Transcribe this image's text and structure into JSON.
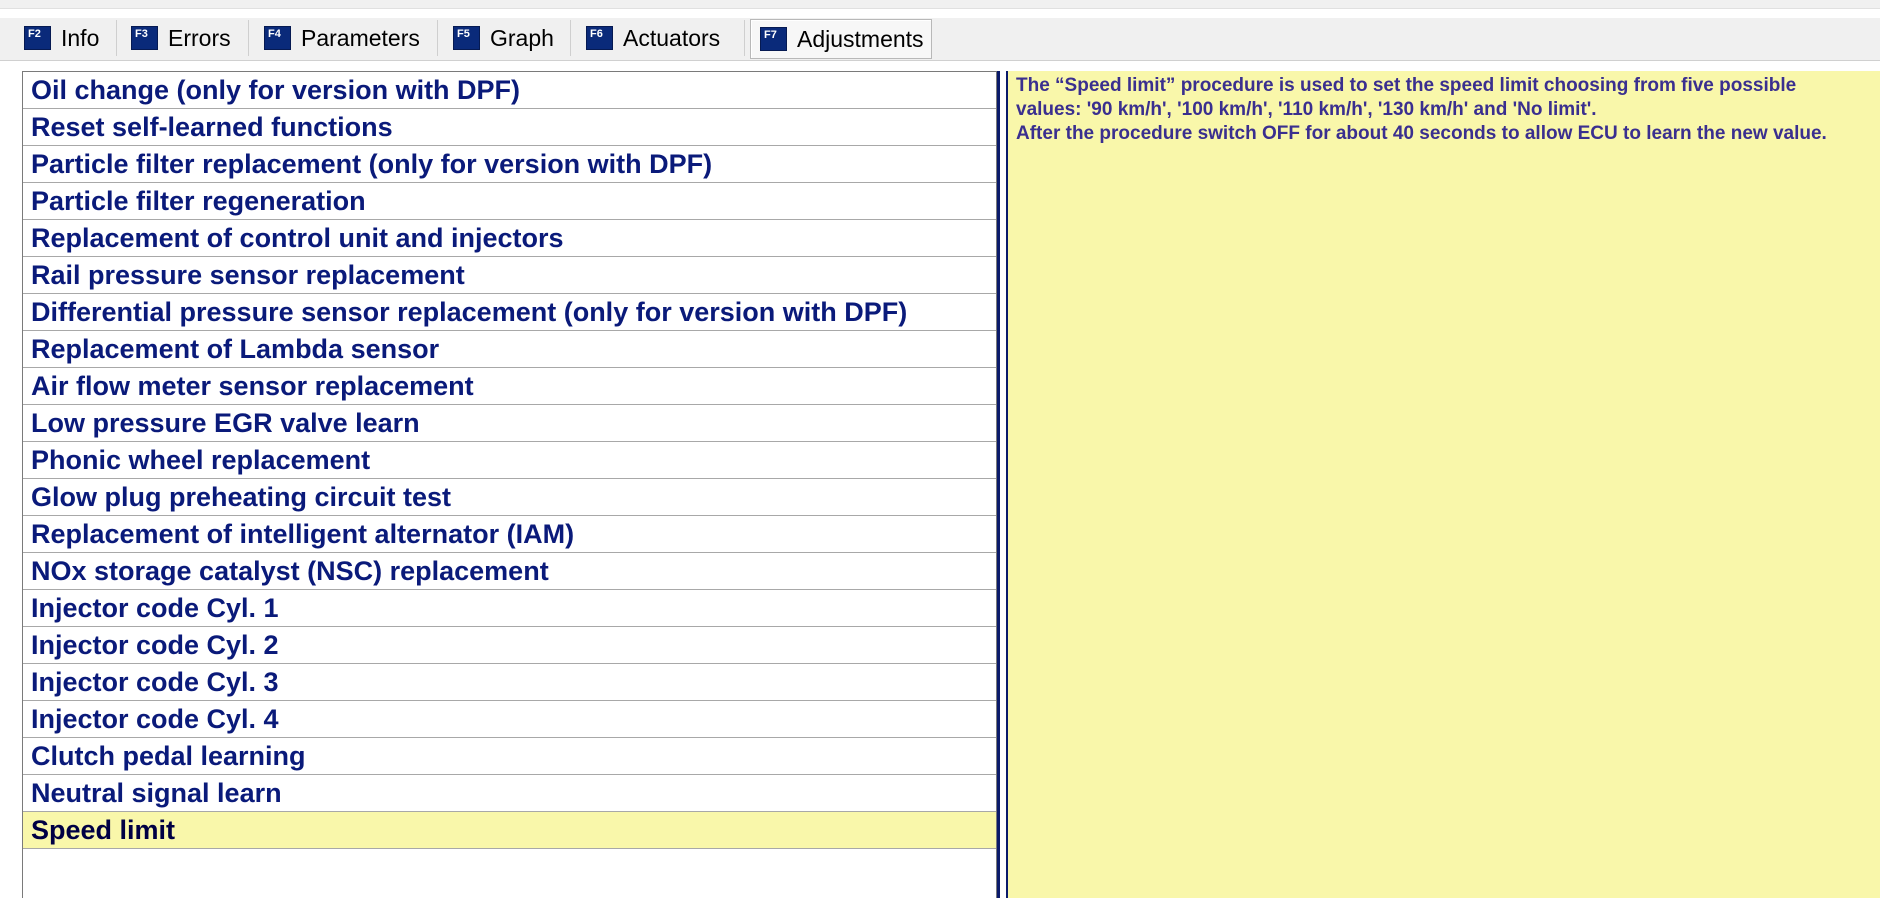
{
  "tabs": [
    {
      "key": "F2",
      "label": "Info",
      "active": false
    },
    {
      "key": "F3",
      "label": "Errors",
      "active": false
    },
    {
      "key": "F4",
      "label": "Parameters",
      "active": false
    },
    {
      "key": "F5",
      "label": "Graph",
      "active": false
    },
    {
      "key": "F6",
      "label": "Actuators",
      "active": false
    },
    {
      "key": "F7",
      "label": "Adjustments",
      "active": true
    }
  ],
  "procedures": [
    "Oil change (only for version with DPF)",
    "Reset self-learned functions",
    "Particle filter replacement (only for version with DPF)",
    "Particle filter regeneration",
    "Replacement of control unit and injectors",
    "Rail pressure sensor replacement",
    "Differential pressure sensor replacement (only for version with DPF)",
    "Replacement of Lambda sensor",
    "Air flow meter sensor replacement",
    "Low pressure EGR valve learn",
    "Phonic wheel replacement",
    "Glow plug preheating circuit test",
    "Replacement of intelligent alternator (IAM)",
    "NOx storage catalyst (NSC) replacement",
    "Injector code Cyl. 1",
    "Injector code Cyl. 2",
    "Injector code Cyl. 3",
    "Injector code Cyl. 4",
    "Clutch pedal learning",
    "Neutral signal learn",
    "Speed limit"
  ],
  "selected_procedure": "Speed limit",
  "description": {
    "lines": [
      "The “Speed limit” procedure is used to set the speed limit choosing from five possible",
      "values: '90 km/h', '100 km/h', '110 km/h', '130 km/h' and 'No limit'.",
      "After the procedure switch OFF for about 40 seconds to allow ECU to learn the new value."
    ]
  },
  "colors": {
    "list_text": "#0a1a7a",
    "selected_bg": "#f9f7aa",
    "desc_bg": "#f9f7aa",
    "desc_text": "#3a2f8f",
    "fkey_bg": "#0a2a7a"
  }
}
